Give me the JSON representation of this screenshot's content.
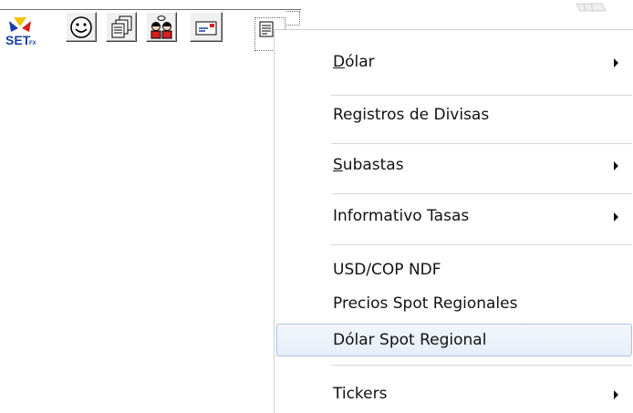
{
  "toolbar": {
    "set_logo_text": "SET",
    "set_logo_sub": "FX",
    "icons": [
      "set-fx-logo-icon",
      "smiley-icon",
      "stacked-documents-icon",
      "people-icon",
      "mail-icon",
      "menu-document-icon"
    ]
  },
  "menu": {
    "items": [
      {
        "first": "D",
        "rest": "ólar",
        "submenu": true
      },
      {
        "first": "",
        "rest": "Registros de Divisas",
        "submenu": false
      },
      {
        "first": "S",
        "rest": "ubastas",
        "submenu": true
      },
      {
        "first": "",
        "rest": "Informativo Tasas",
        "submenu": true
      },
      {
        "first": "",
        "rest": "USD/COP NDF",
        "submenu": false
      },
      {
        "first": "",
        "rest": "Precios Spot Regionales",
        "submenu": false
      },
      {
        "first": "",
        "rest": "Dólar Spot Regional",
        "submenu": false,
        "highlighted": true
      },
      {
        "first": "",
        "rest": "Tickers",
        "submenu": true
      }
    ]
  },
  "colors": {
    "highlight_border": "#a9c2e4",
    "highlight_fill": "#e6eef8",
    "logo_blue": "#1a3fa8",
    "logo_red": "#d42020",
    "logo_yellow": "#f2c400"
  }
}
